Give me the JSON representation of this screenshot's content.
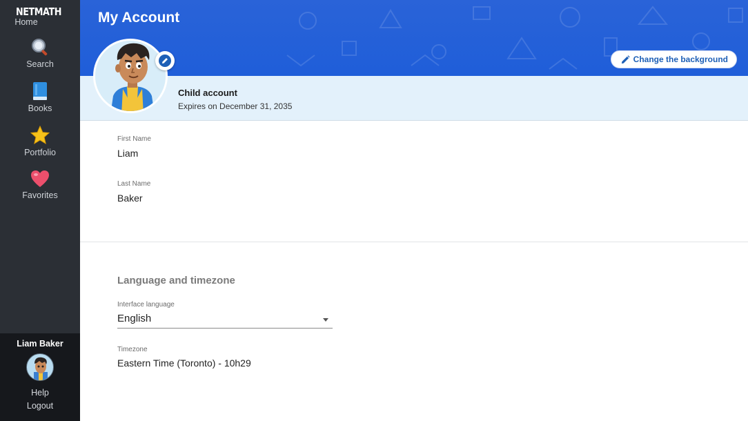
{
  "sidebar": {
    "logo": "NETMATH",
    "items": [
      {
        "label": "Home",
        "icon": "home"
      },
      {
        "label": "Search",
        "icon": "search-icon"
      },
      {
        "label": "Books",
        "icon": "book-icon"
      },
      {
        "label": "Portfolio",
        "icon": "star-icon"
      },
      {
        "label": "Favorites",
        "icon": "heart-icon"
      }
    ],
    "user_name": "Liam Baker",
    "help": "Help",
    "logout": "Logout"
  },
  "header": {
    "title": "My Account",
    "change_bg_label": "Change the background"
  },
  "account": {
    "type": "Child account",
    "expires": "Expires on December 31, 2035"
  },
  "profile": {
    "first_name_label": "First Name",
    "first_name": "Liam",
    "last_name_label": "Last Name",
    "last_name": "Baker"
  },
  "language_section": {
    "title": "Language and timezone",
    "language_label": "Interface language",
    "language_value": "English",
    "timezone_label": "Timezone",
    "timezone_value": "Eastern Time (Toronto) - 10h29"
  },
  "colors": {
    "sidebar_bg": "#2b2f35",
    "header_blue": "#2a63d8",
    "band_bg": "#e3f1fb",
    "accent": "#1d5fb6"
  }
}
